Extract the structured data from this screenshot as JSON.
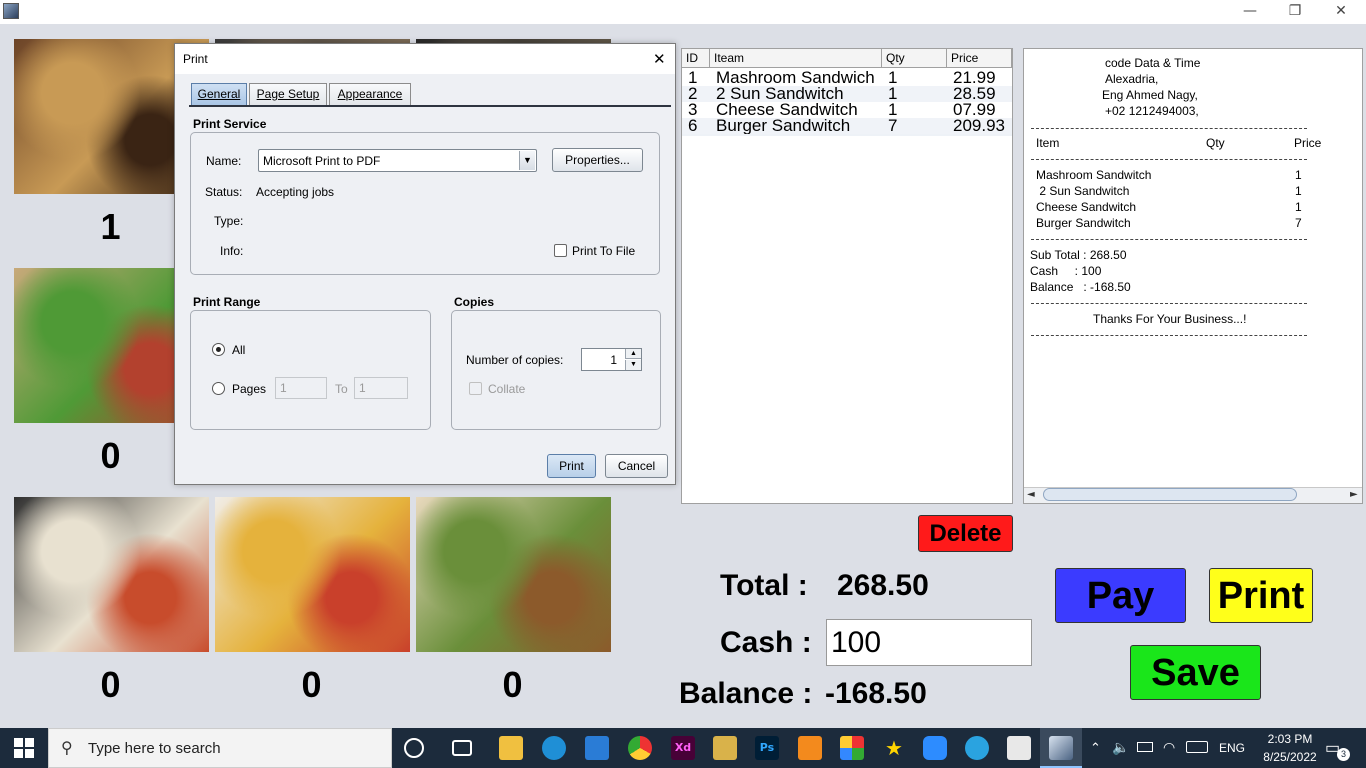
{
  "titlebar": {
    "minimize": "—",
    "restore": "❐",
    "close": "✕"
  },
  "tiles": [
    {
      "name": "grilled-sandwich",
      "qty": "1",
      "colors": [
        "#6b4327",
        "#c89a55",
        "#3a2414"
      ]
    },
    {
      "name": "tile-2",
      "qty": "",
      "colors": [
        "#3c3c3c",
        "#7b6a55",
        "#222"
      ]
    },
    {
      "name": "tile-3",
      "qty": "",
      "colors": [
        "#2a2a2a",
        "#5e5547",
        "#1b1b1b"
      ]
    },
    {
      "name": "veggie-sandwich",
      "qty": "0",
      "colors": [
        "#c8a97a",
        "#4f9a36",
        "#b3412e"
      ]
    },
    {
      "name": "cheese-sandwich",
      "qty": "0",
      "colors": [
        "#2f2f2f",
        "#e8e1d0",
        "#c84c2c"
      ]
    },
    {
      "name": "wrap-fries",
      "qty": "0",
      "colors": [
        "#f1ede7",
        "#e5b23c",
        "#c9402b"
      ]
    },
    {
      "name": "falafel-pita",
      "qty": "0",
      "colors": [
        "#e9d9bd",
        "#6a8f3a",
        "#8c5a2b"
      ]
    }
  ],
  "order_table": {
    "headers": [
      "ID",
      "Iteam",
      "Qty",
      "Price"
    ],
    "rows": [
      [
        "1",
        "Mashroom Sandwich",
        "1",
        "21.99"
      ],
      [
        "2",
        " 2 Sun Sandwitch",
        "1",
        "28.59"
      ],
      [
        "3",
        "Cheese Sandwitch",
        "1",
        "07.99"
      ],
      [
        "6",
        "Burger Sandwitch",
        "7",
        "209.93"
      ]
    ]
  },
  "receipt": {
    "header": [
      "code Data & Time",
      "Alexadria,",
      "Eng Ahmed Nagy,",
      "+02 1212494003,"
    ],
    "cols": {
      "item": "Item",
      "qty": "Qty",
      "price": "Price"
    },
    "items": [
      {
        "name": "Mashroom Sandwitch",
        "qty": "1"
      },
      {
        "name": " 2 Sun Sandwitch",
        "qty": "1"
      },
      {
        "name": "Cheese Sandwitch",
        "qty": "1"
      },
      {
        "name": "Burger Sandwitch",
        "qty": "7"
      }
    ],
    "subtotal": "Sub Total : 268.50",
    "cash": "Cash     : 100",
    "balance": "Balance   : -168.50",
    "thanks": "Thanks For Your Business...!",
    "scroll_left": "◄",
    "scroll_right": "►"
  },
  "actions": {
    "delete": "Delete",
    "pay": "Pay",
    "print": "Print",
    "save": "Save",
    "colors": {
      "delete": "#ff1a1a",
      "pay": "#3b3bff",
      "print": "#ffff1a",
      "save": "#1ae61a"
    }
  },
  "totals": {
    "total_label": "Total :",
    "total_value": "268.50",
    "cash_label": "Cash :",
    "cash_value": "100",
    "balance_label": "Balance :",
    "balance_value": "-168.50"
  },
  "dialog": {
    "title": "Print",
    "close": "✕",
    "tabs": [
      "General",
      "Page Setup",
      "Appearance"
    ],
    "print_service": {
      "group_label": "Print Service",
      "name_label": "Name:",
      "name_value": "Microsoft Print to PDF",
      "properties": "Properties...",
      "status_label": "Status:",
      "status_value": "Accepting jobs",
      "type_label": "Type:",
      "info_label": "Info:",
      "print_to_file": "Print To File"
    },
    "print_range": {
      "group_label": "Print Range",
      "all": "All",
      "pages": "Pages",
      "from_value": "1",
      "to_label": "To",
      "to_value": "1"
    },
    "copies": {
      "group_label": "Copies",
      "number_label": "Number of copies:",
      "number_value": "1",
      "collate": "Collate"
    },
    "print_button": "Print",
    "cancel_button": "Cancel"
  },
  "taskbar": {
    "search_placeholder": "Type here to search",
    "apps": [
      "task-view",
      "file-explorer",
      "edge",
      "vscode",
      "chrome",
      "adobe-xd",
      "files",
      "photoshop",
      "sublime",
      "office",
      "star-app",
      "zoom",
      "telegram",
      "3d-app",
      "java-app"
    ],
    "language": "ENG",
    "time": "2:03 PM",
    "date": "8/25/2022",
    "notifications": "3"
  }
}
